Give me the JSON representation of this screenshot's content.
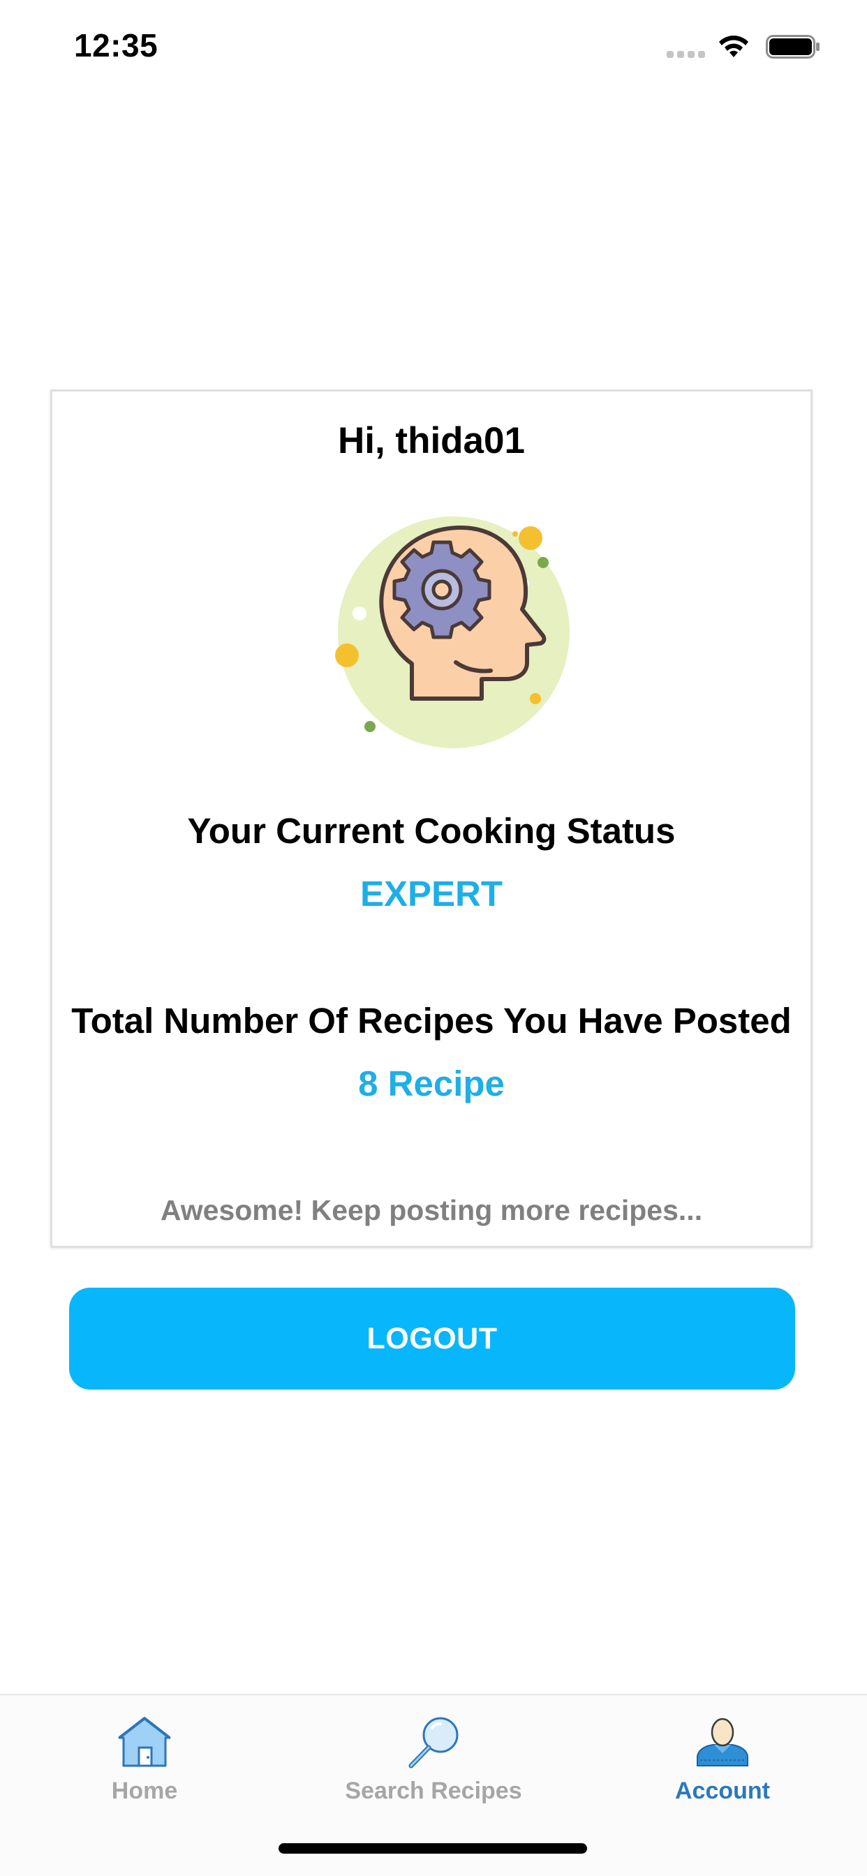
{
  "status_bar": {
    "time": "12:35"
  },
  "account_card": {
    "greeting": "Hi, thida01",
    "illustration_icon": "head-with-gear-icon",
    "status_heading": "Your Current Cooking Status",
    "status_value": "EXPERT",
    "recipes_heading": "Total Number Of Recipes You Have Posted",
    "recipes_value": "8 Recipe",
    "encouragement": "Awesome! Keep posting more recipes..."
  },
  "logout_button": {
    "label": "LOGOUT"
  },
  "tab_bar": {
    "tabs": [
      {
        "label": "Home",
        "icon": "home-icon",
        "active": false
      },
      {
        "label": "Search Recipes",
        "icon": "search-icon",
        "active": false
      },
      {
        "label": "Account",
        "icon": "account-icon",
        "active": true
      }
    ]
  },
  "colors": {
    "accent": "#1eaee8",
    "button_background": "#08b6fb",
    "active_tab": "#2a78bd",
    "inactive_tab": "#a6a6a6",
    "muted_text": "#808080"
  }
}
